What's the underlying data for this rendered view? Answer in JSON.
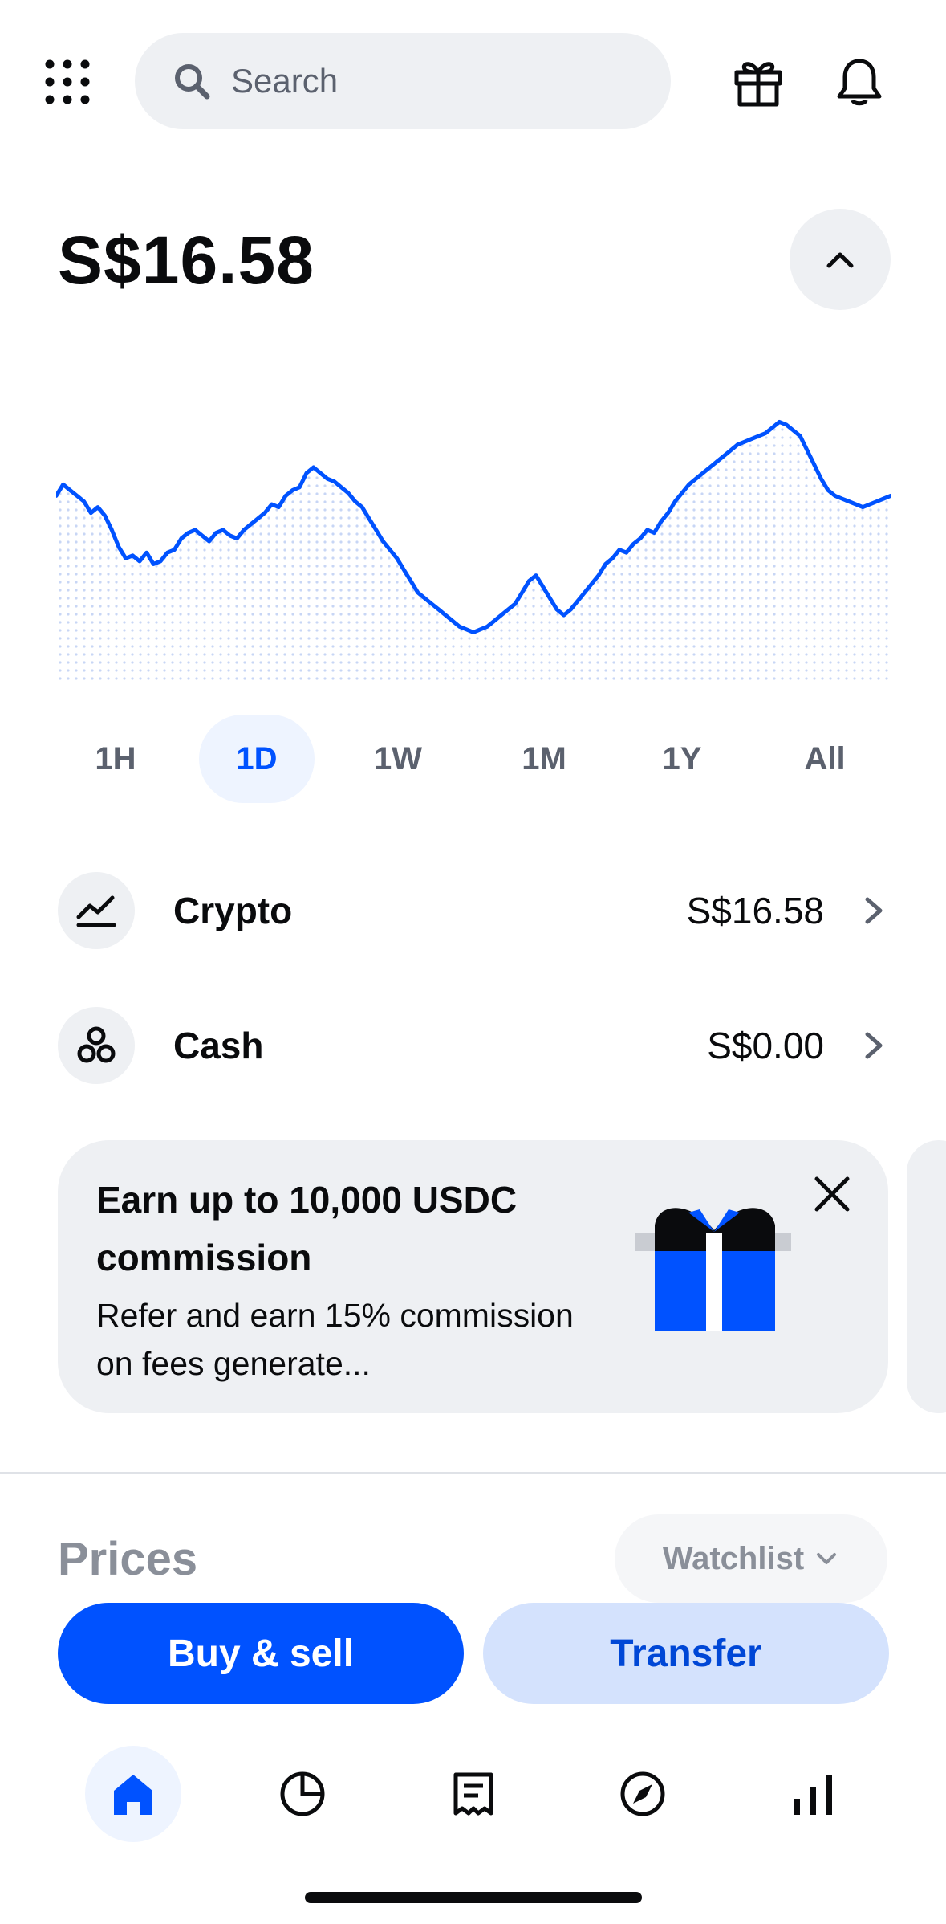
{
  "header": {
    "menu_icon": "grid-icon",
    "search_placeholder": "Search",
    "search_icon": "search-icon",
    "gift_icon": "gift-icon",
    "notification_icon": "bell-icon"
  },
  "balance": {
    "amount": "S$16.58",
    "collapse_icon": "chevron-up-icon"
  },
  "chart_data": {
    "type": "line",
    "title": "",
    "xlabel": "",
    "ylabel": "",
    "series": [
      {
        "values": [
          64,
          68,
          66,
          64,
          62,
          58,
          60,
          57,
          52,
          46,
          42,
          43,
          41,
          44,
          40,
          41,
          44,
          45,
          49,
          51,
          52,
          50,
          48,
          51,
          52,
          50,
          49,
          52,
          54,
          56,
          58,
          61,
          60,
          64,
          66,
          67,
          72,
          74,
          72,
          70,
          69,
          67,
          65,
          62,
          60,
          56,
          52,
          48,
          45,
          42,
          38,
          34,
          30,
          28,
          26,
          24,
          22,
          20,
          18,
          17,
          16,
          17,
          18,
          20,
          22,
          24,
          26,
          30,
          34,
          36,
          32,
          28,
          24,
          22,
          24,
          27,
          30,
          33,
          36,
          40,
          42,
          45,
          44,
          47,
          49,
          52,
          51,
          55,
          58,
          62,
          65,
          68,
          70,
          72,
          74,
          76,
          78,
          80,
          82,
          83,
          84,
          85,
          86,
          88,
          90,
          89,
          87,
          85,
          80,
          75,
          70,
          66,
          64,
          63,
          62,
          61,
          60,
          61,
          62,
          63,
          64
        ]
      }
    ],
    "ylim": [
      0,
      100
    ],
    "grid": false,
    "range_selected": "1D",
    "line_color": "#0052ff",
    "fill": "dotted"
  },
  "ranges": [
    {
      "label": "1H",
      "active": false
    },
    {
      "label": "1D",
      "active": true
    },
    {
      "label": "1W",
      "active": false
    },
    {
      "label": "1M",
      "active": false
    },
    {
      "label": "1Y",
      "active": false
    },
    {
      "label": "All",
      "active": false
    }
  ],
  "assets": [
    {
      "icon": "trend-icon",
      "label": "Crypto",
      "value": "S$16.58"
    },
    {
      "icon": "cash-icon",
      "label": "Cash",
      "value": "S$0.00"
    }
  ],
  "promo": {
    "title": "Earn up to 10,000 USDC commission",
    "description": "Refer and earn 15% commission on fees generate...",
    "close_icon": "close-icon",
    "art": "gift-box-illustration"
  },
  "prices": {
    "title": "Prices",
    "filter_label": "Watchlist"
  },
  "actions": {
    "buy_sell": "Buy & sell",
    "transfer": "Transfer"
  },
  "nav": [
    {
      "icon": "home-icon",
      "active": true
    },
    {
      "icon": "portfolio-pie-icon",
      "active": false
    },
    {
      "icon": "receipt-icon",
      "active": false
    },
    {
      "icon": "compass-icon",
      "active": false
    },
    {
      "icon": "bar-chart-icon",
      "active": false
    }
  ],
  "colors": {
    "accent": "#0052ff",
    "accent_light": "#d4e2fd",
    "surface": "#eef0f3"
  }
}
